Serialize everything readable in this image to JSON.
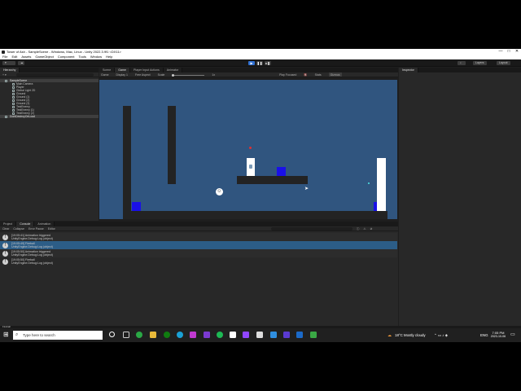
{
  "window": {
    "title": "Tower of Ash - SampleScene - Windows, Mac, Linux - Unity 2022.3.9f1 <DX11>",
    "controls": [
      "—",
      "□",
      "✕"
    ]
  },
  "menu": [
    "File",
    "Edit",
    "Assets",
    "GameObject",
    "Component",
    "Tools",
    "Window",
    "Help"
  ],
  "toolbar": {
    "layers": "Layers",
    "layout": "Layout"
  },
  "hierarchy": {
    "tab": "Hierarchy",
    "items": [
      {
        "label": "SampleScene",
        "root": true
      },
      {
        "label": "Main Camera"
      },
      {
        "label": "Player"
      },
      {
        "label": "Global Light 2D"
      },
      {
        "label": "Ground"
      },
      {
        "label": "Ground (1)"
      },
      {
        "label": "Ground (2)"
      },
      {
        "label": "Ground (3)"
      },
      {
        "label": "TestEnemy"
      },
      {
        "label": "TestEnemy (1)"
      },
      {
        "label": "TestEnemy (2)"
      },
      {
        "label": "DontDestroyOnLoad",
        "root": true
      }
    ]
  },
  "center_tabs": [
    "Scene",
    "Game",
    "Player Input Actions",
    "Animator"
  ],
  "game_bar": {
    "display_mode": "Game",
    "display": "Display 1",
    "aspect": "Free Aspect",
    "scale_label": "Scale",
    "scale_value": "1x",
    "play_focused": "Play Focused",
    "stats": "Stats",
    "gizmos": "Gizmos"
  },
  "inspector": {
    "tab": "Inspector"
  },
  "bottom_tabs": [
    "Project",
    "Console",
    "Animation"
  ],
  "console_bar": [
    "Clear",
    "Collapse",
    "Error Pause",
    "Editor"
  ],
  "logs": [
    {
      "time_msg": "[19:05:41] Animation triggered",
      "detail": "UnityEngine.Debug:Log (object)",
      "selected": false
    },
    {
      "time_msg": "[19:05:49] Fireball",
      "detail": "UnityEngine.Debug:Log (object)",
      "selected": true
    },
    {
      "time_msg": "[19:05:50] Animation triggered",
      "detail": "UnityEngine.Debug:Log (object)",
      "selected": false
    },
    {
      "time_msg": "[19:05:50] Fireball",
      "detail": "UnityEngine.Debug:Log (object)",
      "selected": false
    }
  ],
  "status_bar": "Fireball",
  "taskbar": {
    "search": "Type here to search",
    "weather": "18°C  Mostly cloudy",
    "lang": "ENG",
    "time": "7:05 PM",
    "date": "2023-10-06"
  },
  "colors": {
    "game_bg": "#30557f",
    "platform": "#232323",
    "enemy": "#1a10e8",
    "player": "#ffffff",
    "accent": "#2f6fd1"
  }
}
